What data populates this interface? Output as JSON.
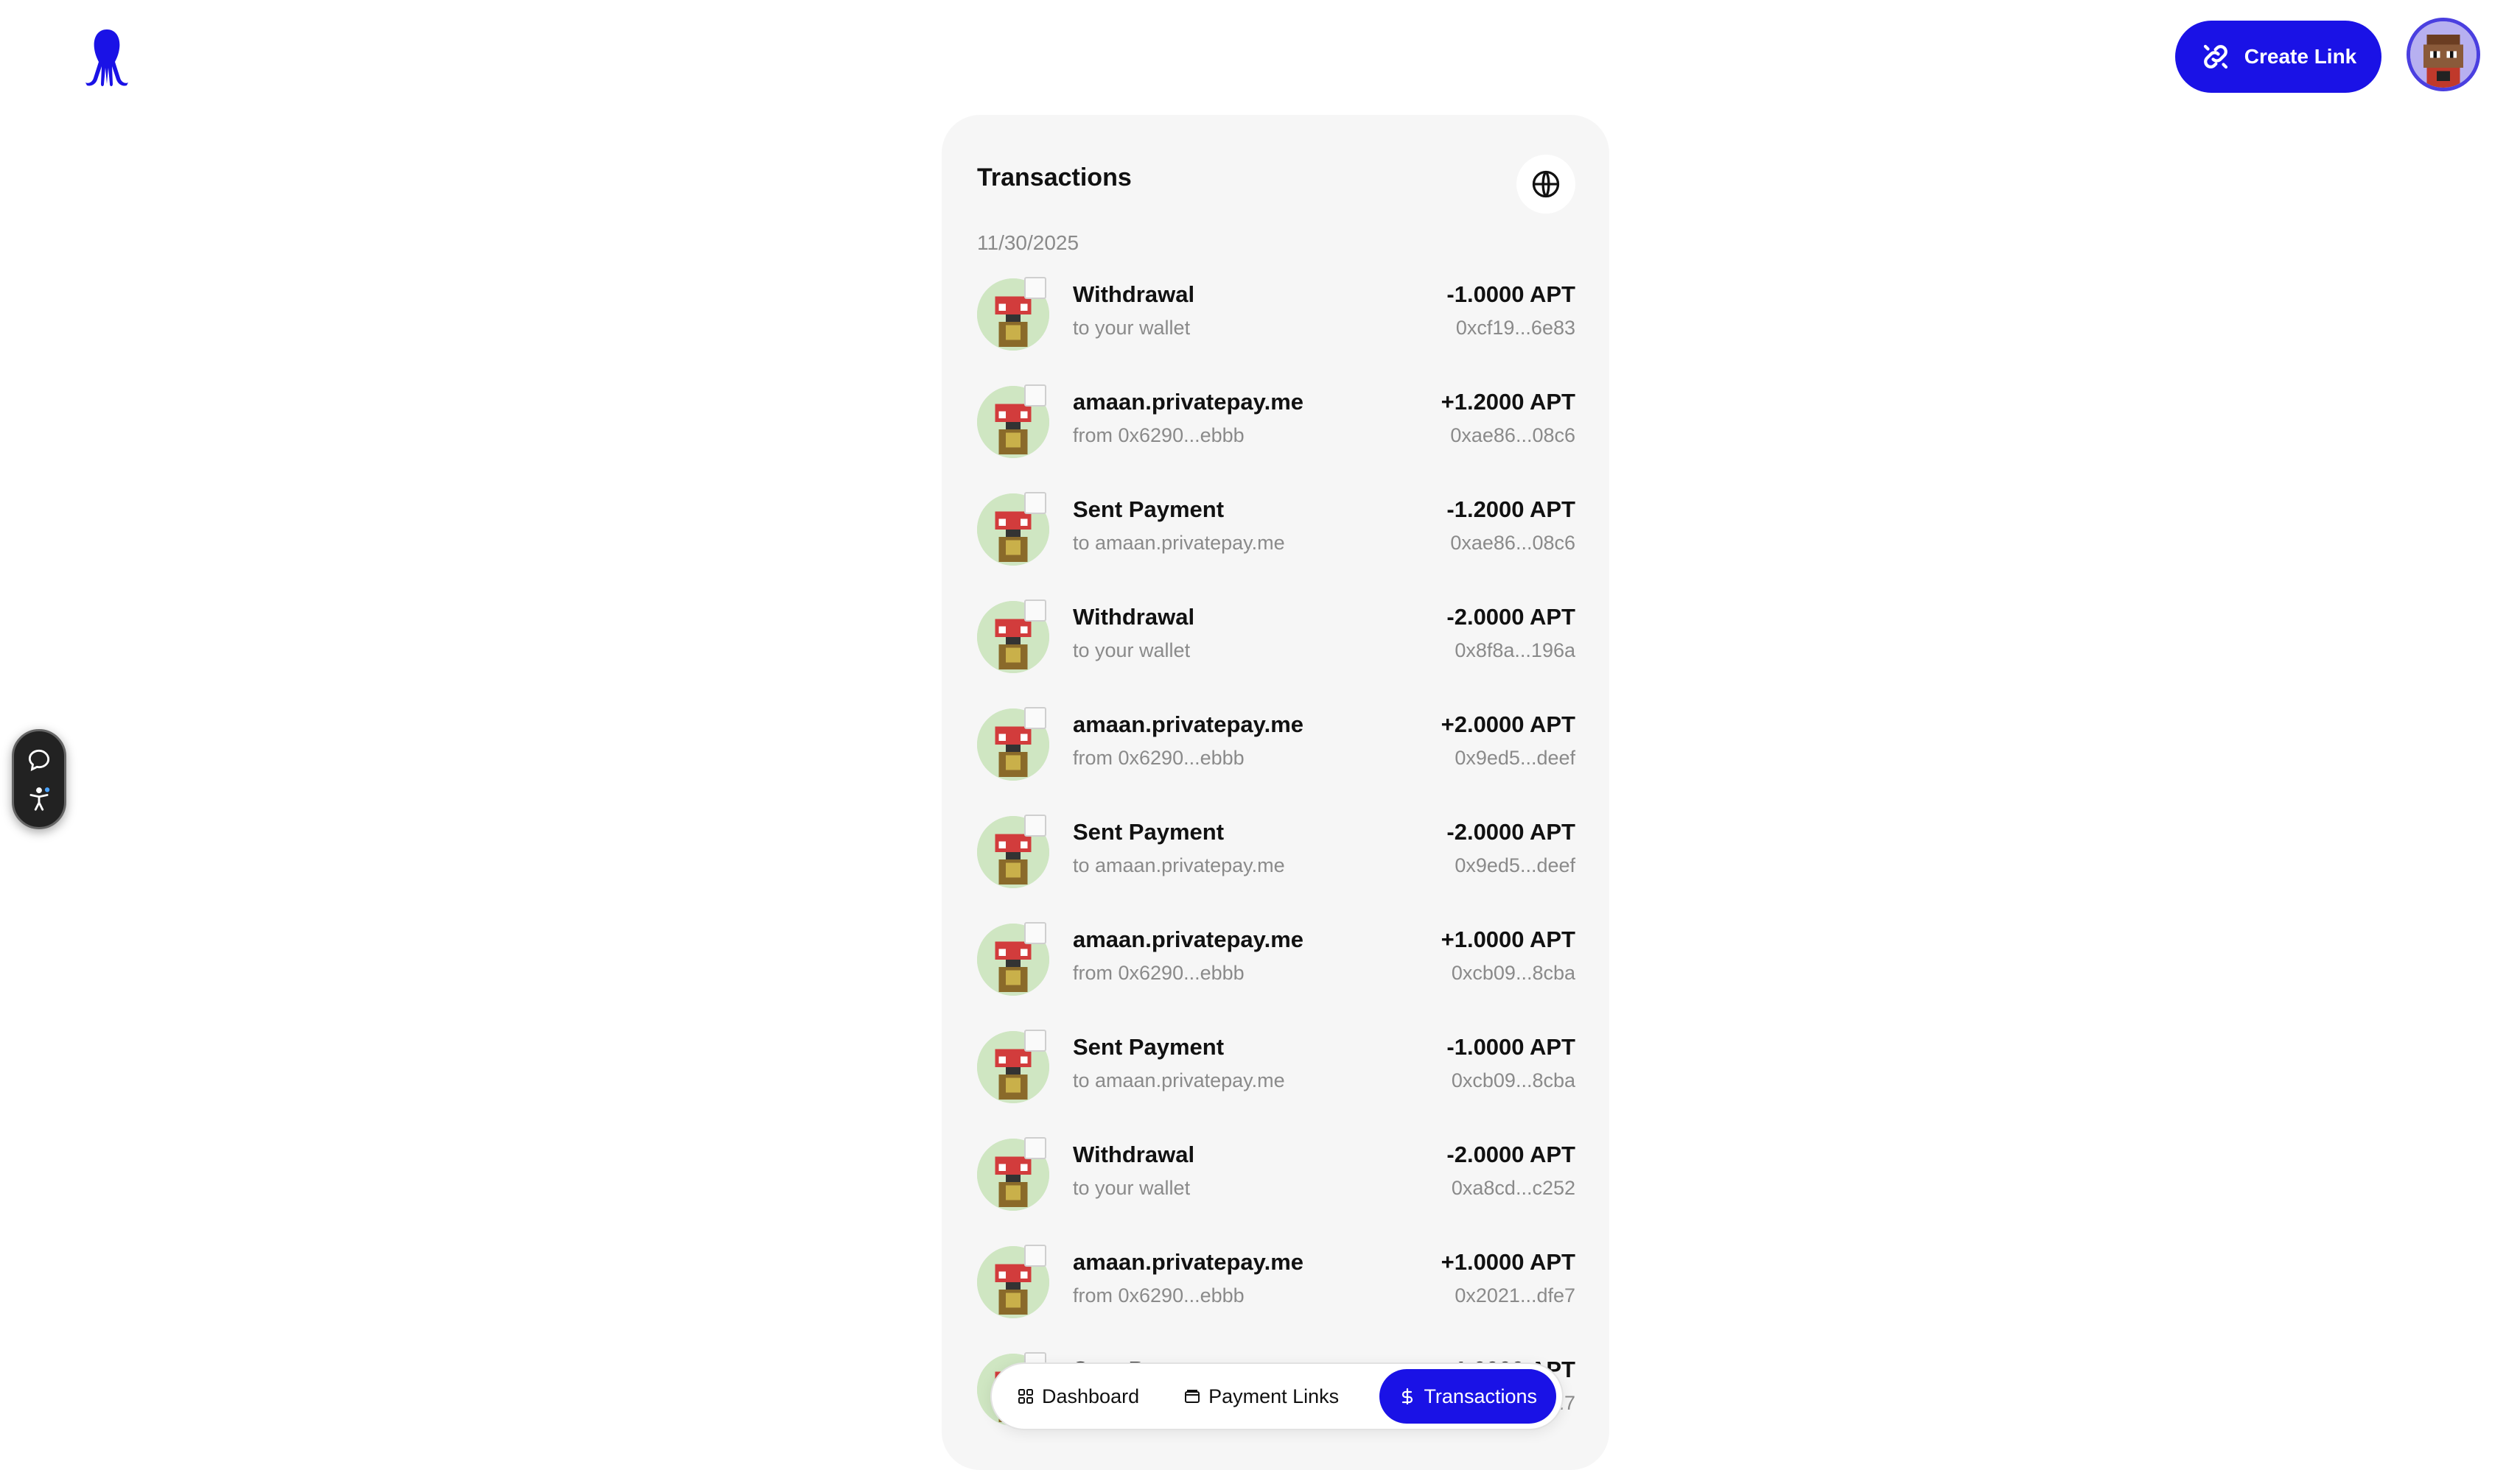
{
  "header": {
    "logo_icon": "squid-logo-icon",
    "create_link_label": "Create Link",
    "create_link_icon": "link-icon",
    "avatar_icon": "pixel-avatar"
  },
  "side_widget": {
    "icons": [
      "chat-bubble-icon",
      "accessibility-icon"
    ]
  },
  "panel": {
    "title": "Transactions",
    "globe_icon": "globe-icon",
    "date": "11/30/2025"
  },
  "transactions": [
    {
      "title": "Withdrawal",
      "subtitle": "to your wallet",
      "amount": "-1.0000 APT",
      "hash": "0xcf19...6e83"
    },
    {
      "title": "amaan.privatepay.me",
      "subtitle": "from 0x6290...ebbb",
      "amount": "+1.2000 APT",
      "hash": "0xae86...08c6"
    },
    {
      "title": "Sent Payment",
      "subtitle": "to amaan.privatepay.me",
      "amount": "-1.2000 APT",
      "hash": "0xae86...08c6"
    },
    {
      "title": "Withdrawal",
      "subtitle": "to your wallet",
      "amount": "-2.0000 APT",
      "hash": "0x8f8a...196a"
    },
    {
      "title": "amaan.privatepay.me",
      "subtitle": "from 0x6290...ebbb",
      "amount": "+2.0000 APT",
      "hash": "0x9ed5...deef"
    },
    {
      "title": "Sent Payment",
      "subtitle": "to amaan.privatepay.me",
      "amount": "-2.0000 APT",
      "hash": "0x9ed5...deef"
    },
    {
      "title": "amaan.privatepay.me",
      "subtitle": "from 0x6290...ebbb",
      "amount": "+1.0000 APT",
      "hash": "0xcb09...8cba"
    },
    {
      "title": "Sent Payment",
      "subtitle": "to amaan.privatepay.me",
      "amount": "-1.0000 APT",
      "hash": "0xcb09...8cba"
    },
    {
      "title": "Withdrawal",
      "subtitle": "to your wallet",
      "amount": "-2.0000 APT",
      "hash": "0xa8cd...c252"
    },
    {
      "title": "amaan.privatepay.me",
      "subtitle": "from 0x6290...ebbb",
      "amount": "+1.0000 APT",
      "hash": "0x2021...dfe7"
    },
    {
      "title": "Sent Payment",
      "subtitle": "",
      "amount": "-1.0000 APT",
      "hash": "...7"
    }
  ],
  "bottom_nav": {
    "items": [
      {
        "label": "Dashboard",
        "icon": "grid-icon"
      },
      {
        "label": "Payment Links",
        "icon": "wallet-icon"
      },
      {
        "label": "Transactions",
        "icon": "dollar-icon",
        "active": true
      }
    ]
  },
  "colors": {
    "accent": "#1a12e6",
    "panel_bg": "#f6f6f6",
    "muted_text": "#8a8a8a"
  }
}
